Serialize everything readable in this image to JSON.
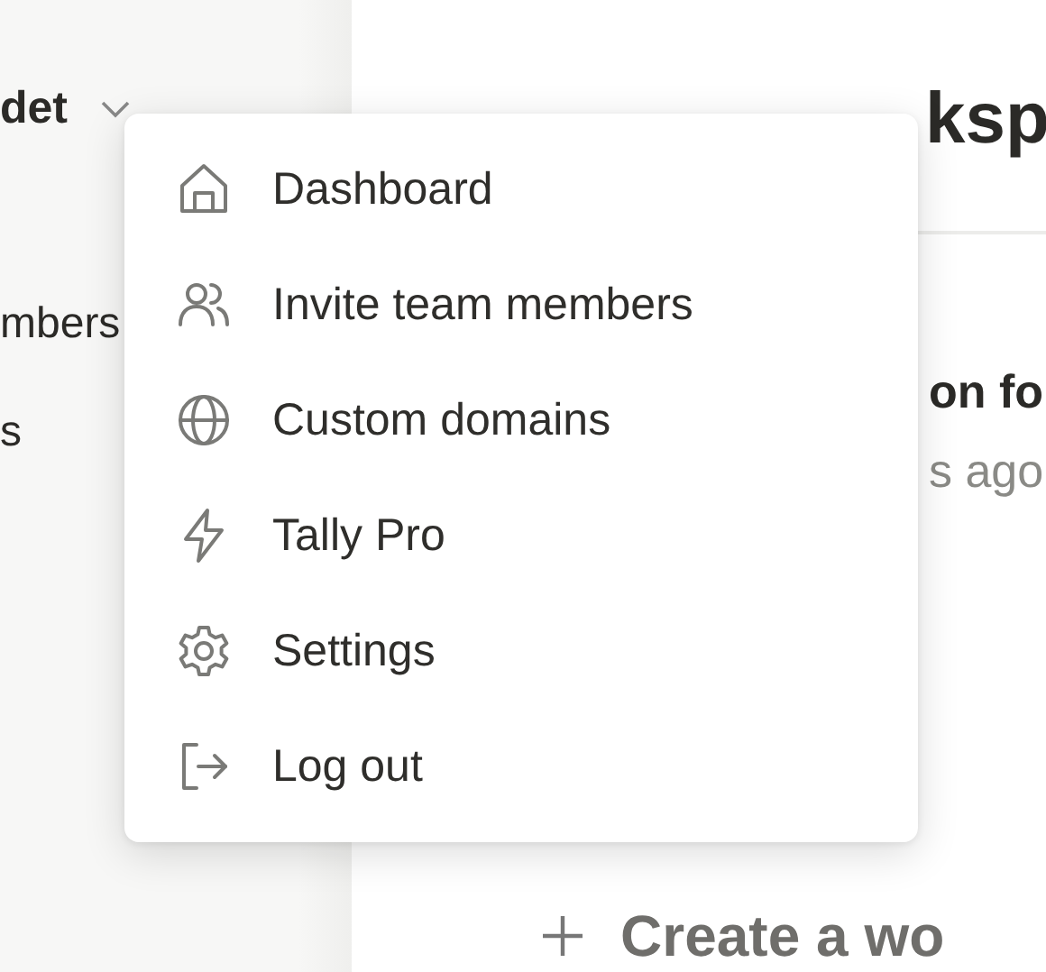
{
  "sidebar": {
    "workspace_name": "det",
    "items": [
      "mbers",
      "s"
    ]
  },
  "main": {
    "title": "ksp",
    "recent": {
      "title": "on fo",
      "time": "s ago"
    },
    "create_button": "Create a wo"
  },
  "menu": {
    "items": [
      {
        "kind": "home",
        "label": "Dashboard"
      },
      {
        "kind": "users",
        "label": "Invite team members"
      },
      {
        "kind": "globe",
        "label": "Custom domains"
      },
      {
        "kind": "bolt",
        "label": "Tally Pro"
      },
      {
        "kind": "gear",
        "label": "Settings"
      },
      {
        "kind": "logout",
        "label": "Log out"
      }
    ]
  }
}
